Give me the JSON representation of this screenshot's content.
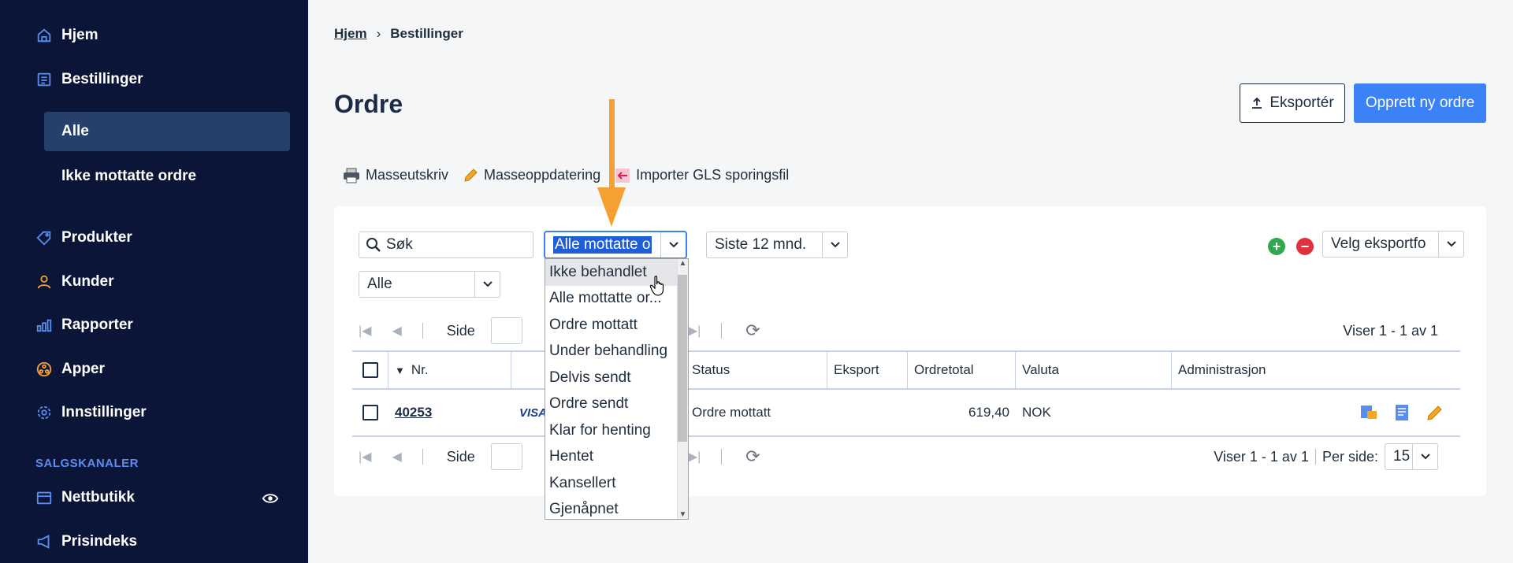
{
  "sidebar": {
    "items": [
      {
        "label": "Hjem",
        "icon": "home-icon"
      },
      {
        "label": "Bestillinger",
        "icon": "orders-icon"
      },
      {
        "label": "Produkter",
        "icon": "tag-icon"
      },
      {
        "label": "Kunder",
        "icon": "user-icon"
      },
      {
        "label": "Rapporter",
        "icon": "bar-chart-icon"
      },
      {
        "label": "Apper",
        "icon": "apps-icon"
      },
      {
        "label": "Innstillinger",
        "icon": "gear-icon"
      }
    ],
    "subitems": [
      {
        "label": "Alle",
        "active": true
      },
      {
        "label": "Ikke mottatte ordre",
        "active": false
      }
    ],
    "section_heading": "SALGSKANALER",
    "channels": [
      {
        "label": "Nettbutikk",
        "icon": "store-icon"
      },
      {
        "label": "Prisindeks",
        "icon": "megaphone-icon"
      }
    ]
  },
  "breadcrumb": {
    "home": "Hjem",
    "current": "Bestillinger"
  },
  "page": {
    "title": "Ordre",
    "export_label": "Eksportér",
    "new_order_label": "Opprett ny ordre"
  },
  "toolbar": {
    "bulk_print": "Masseutskriv",
    "bulk_update": "Masseoppdatering",
    "import_gls": "Importer GLS sporingsfil"
  },
  "filters": {
    "search_label": "Søk",
    "status_value": "Alle mottatte o",
    "period_value": "Siste 12 mnd.",
    "type_value": "Alle",
    "export_format_value": "Velg eksportfo"
  },
  "pager": {
    "page_label": "Side",
    "viewing": "Viser 1 - 1 av 1",
    "per_page_label": "Per side:",
    "per_page_value": "15"
  },
  "table": {
    "columns": [
      "Nr.",
      "Status",
      "Eksport",
      "Ordretotal",
      "Valuta",
      "Administrasjon"
    ],
    "rows": [
      {
        "nr": "40253",
        "payment": "VISA",
        "status": "Ordre mottatt",
        "total": "619,40",
        "currency": "NOK"
      }
    ]
  },
  "dropdown": {
    "options": [
      "Ikke behandlet",
      "Alle mottatte or...",
      "Ordre mottatt",
      "Under behandling",
      "Delvis sendt",
      "Ordre sendt",
      "Klar for henting",
      "Hentet",
      "Kansellert",
      "Gjenåpnet"
    ]
  },
  "colors": {
    "sidebar_bg": "#0a1538",
    "accent": "#3b82f6",
    "annotation": "#f5a031"
  }
}
